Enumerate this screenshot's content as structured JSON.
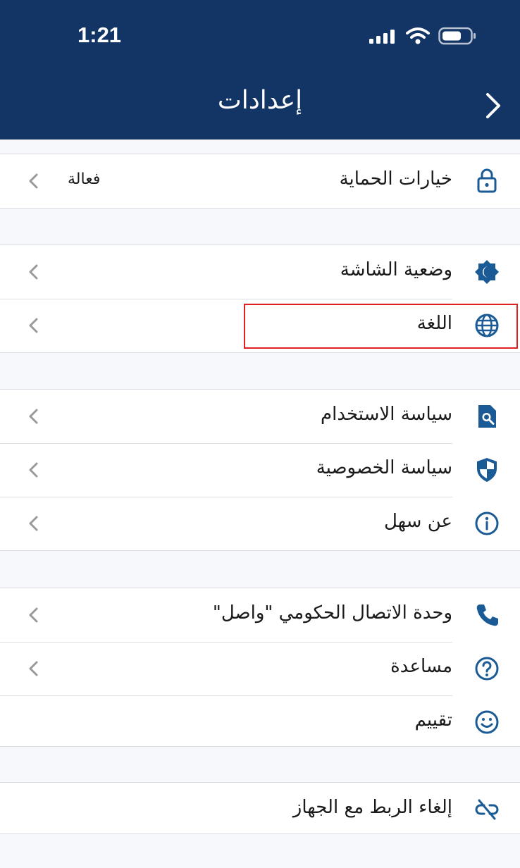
{
  "status_bar": {
    "time": "1:21"
  },
  "header": {
    "title": "إعدادات"
  },
  "sections": [
    {
      "rows": [
        {
          "label": "خيارات الحماية",
          "value": "فعالة",
          "icon": "lock-icon",
          "chevron": true
        }
      ]
    },
    {
      "rows": [
        {
          "label": "وضعية الشاشة",
          "icon": "brightness-icon",
          "chevron": true
        },
        {
          "label": "اللغة",
          "icon": "globe-icon",
          "chevron": true
        }
      ]
    },
    {
      "rows": [
        {
          "label": "سياسة الاستخدام",
          "icon": "document-search-icon",
          "chevron": true
        },
        {
          "label": "سياسة الخصوصية",
          "icon": "shield-icon",
          "chevron": true
        },
        {
          "label": "عن سهل",
          "icon": "info-icon",
          "chevron": true
        }
      ]
    },
    {
      "rows": [
        {
          "label": "وحدة الاتصال الحكومي \"واصل\"",
          "icon": "phone-icon",
          "chevron": true
        },
        {
          "label": "مساعدة",
          "icon": "help-icon",
          "chevron": true
        },
        {
          "label": "تقييم",
          "icon": "smiley-icon",
          "chevron": false
        }
      ]
    },
    {
      "rows": [
        {
          "label": "إلغاء الربط مع الجهاز",
          "icon": "unlink-icon",
          "chevron": false
        }
      ]
    }
  ],
  "colors": {
    "header_bg": "#123566",
    "icon": "#1a5b96",
    "highlight": "#e02020",
    "background": "#f6f8fb"
  }
}
